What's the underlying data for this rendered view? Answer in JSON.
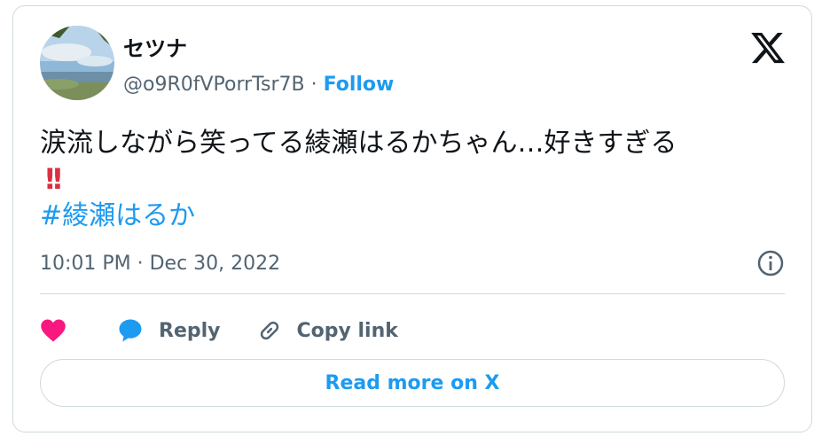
{
  "tweet": {
    "display_name": "セツナ",
    "handle": "@o9R0fVPorrTsr7B",
    "separator": "·",
    "follow_label": "Follow",
    "text": "涙流しながら笑ってる綾瀬はるかちゃん…好きすぎる",
    "emphasis": "!!",
    "hashtag": "#綾瀬はるか",
    "timestamp": "10:01 PM · Dec 30, 2022"
  },
  "actions": {
    "like_icon": "heart-icon",
    "reply_label": "Reply",
    "copy_link_label": "Copy link"
  },
  "footer": {
    "read_more_label": "Read more on X"
  },
  "colors": {
    "accent": "#1d9bf0",
    "heart": "#f91880",
    "text_secondary": "#536471",
    "border": "#cfd9de",
    "emphasis": "#dd2e44"
  }
}
